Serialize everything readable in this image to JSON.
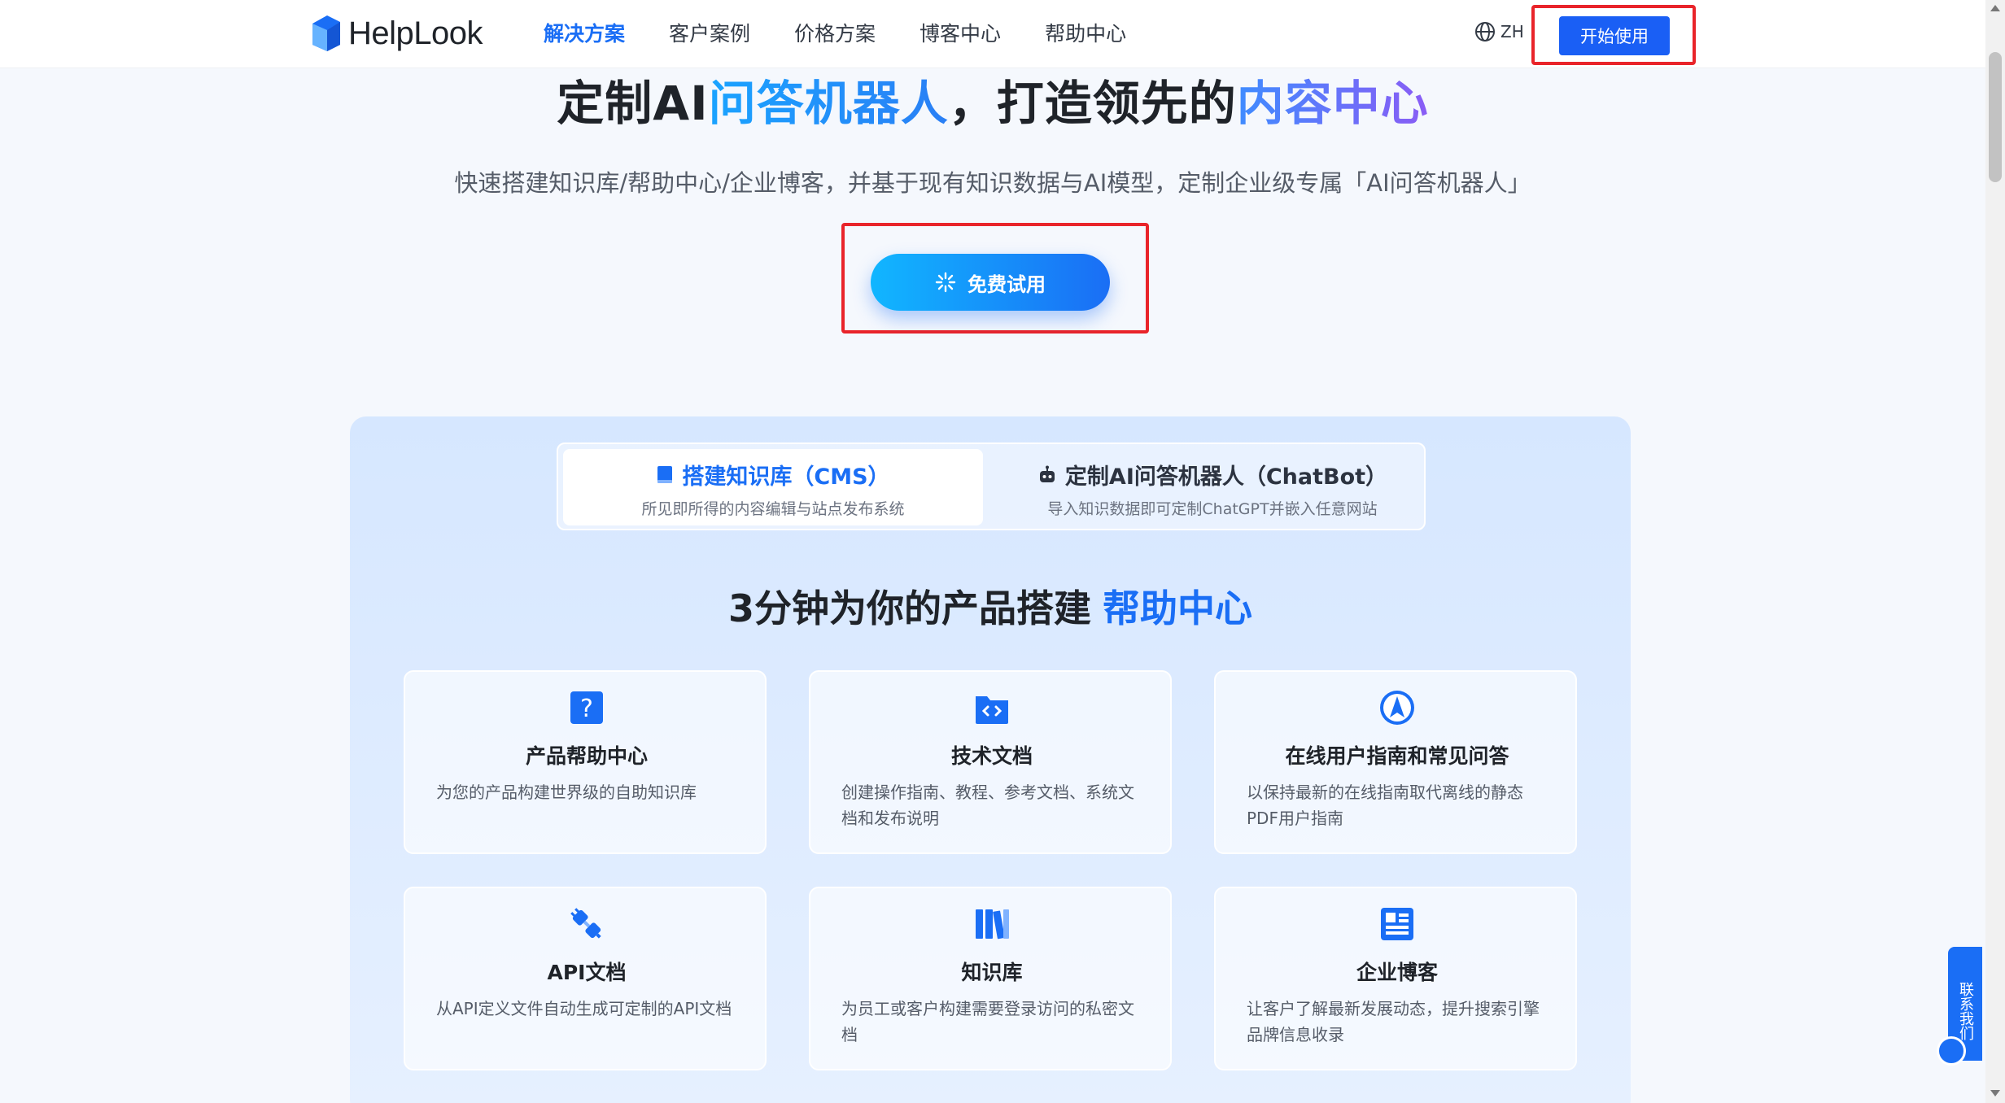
{
  "nav": {
    "brand": "HelpLook",
    "items": [
      "解决方案",
      "客户案例",
      "价格方案",
      "博客中心",
      "帮助中心"
    ],
    "lang": "ZH",
    "start_label": "开始使用"
  },
  "hero": {
    "title_part1": "定制AI",
    "title_part2": "问答机器人",
    "title_part3": "，打造领先的",
    "title_part4": "内容中心",
    "subtitle": "快速搭建知识库/帮助中心/企业博客，并基于现有知识数据与AI模型，定制企业级专属「AI问答机器人」",
    "trial_label": "免费试用"
  },
  "tabs": [
    {
      "title": "搭建知识库（CMS）",
      "desc": "所见即所得的内容编辑与站点发布系统"
    },
    {
      "title": "定制AI问答机器人（ChatBot）",
      "desc": "导入知识数据即可定制ChatGPT并嵌入任意网站"
    }
  ],
  "section": {
    "title": "3分钟为你的产品搭建",
    "highlight": "帮助中心"
  },
  "cards": [
    {
      "title": "产品帮助中心",
      "desc": "为您的产品构建世界级的自助知识库",
      "icon": "help-icon"
    },
    {
      "title": "技术文档",
      "desc": "创建操作指南、教程、参考文档、系统文档和发布说明",
      "icon": "code-folder-icon"
    },
    {
      "title": "在线用户指南和常见问答",
      "desc": "以保持最新的在线指南取代离线的静态PDF用户指南",
      "icon": "navigation-icon"
    },
    {
      "title": "API文档",
      "desc": "从API定义文件自动生成可定制的API文档",
      "icon": "plug-icon"
    },
    {
      "title": "知识库",
      "desc": "为员工或客户构建需要登录访问的私密文档",
      "icon": "books-icon"
    },
    {
      "title": "企业博客",
      "desc": "让客户了解最新发展动态，提升搜索引擎品牌信息收录",
      "icon": "blog-icon"
    }
  ],
  "contact_label": "联系我们",
  "colors": {
    "accent": "#1a6ef5",
    "highlight_box": "#e9242a"
  }
}
